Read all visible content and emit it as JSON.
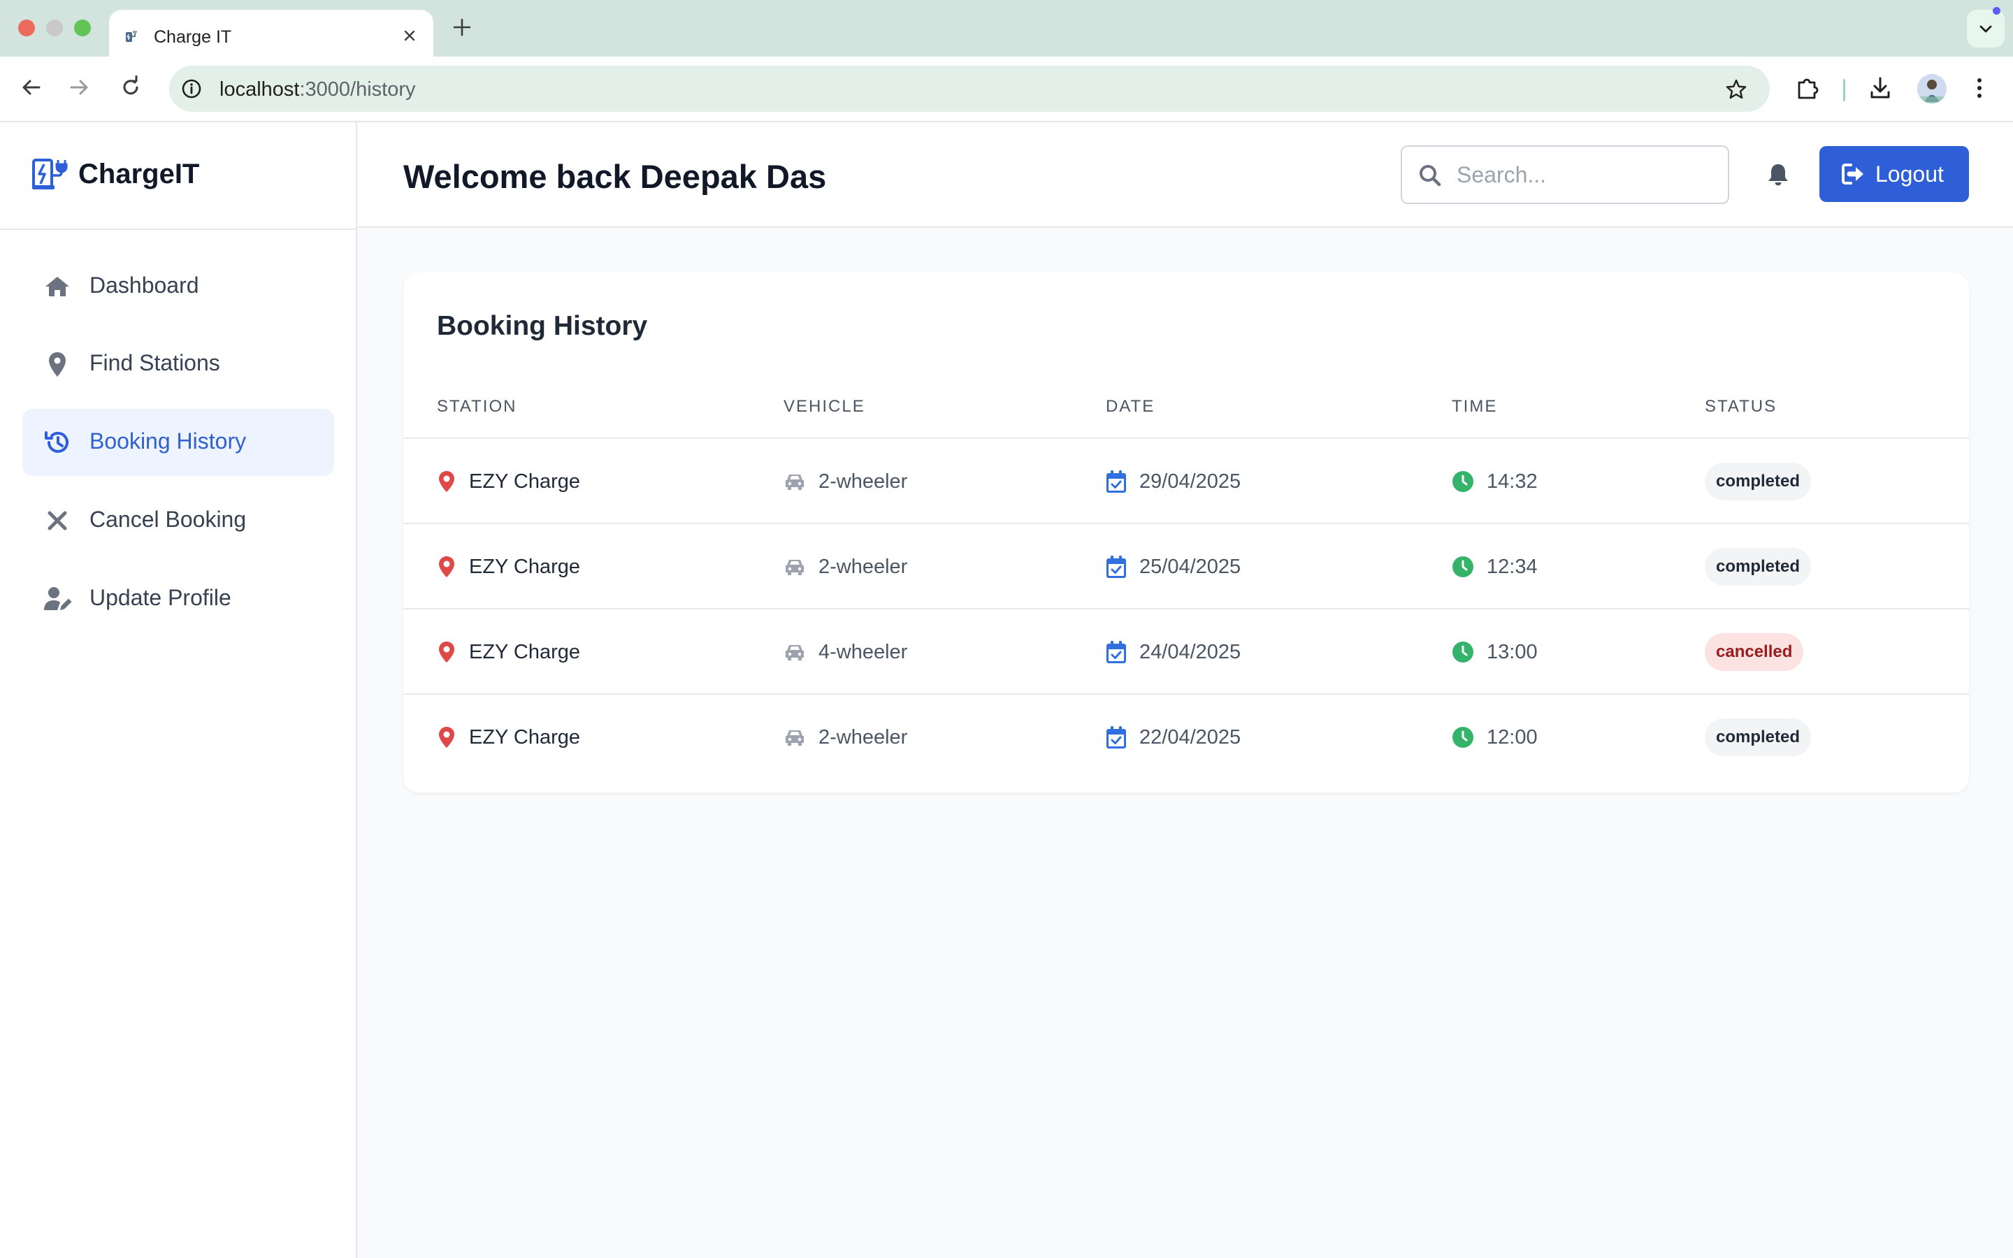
{
  "browser": {
    "tab_title": "Charge IT",
    "url_host": "localhost",
    "url_rest": ":3000/history"
  },
  "sidebar": {
    "brand": "ChargeIT",
    "items": [
      {
        "label": "Dashboard",
        "icon": "home-icon"
      },
      {
        "label": "Find Stations",
        "icon": "map-pin-icon"
      },
      {
        "label": "Booking History",
        "icon": "history-icon",
        "active": true
      },
      {
        "label": "Cancel Booking",
        "icon": "x-icon"
      },
      {
        "label": "Update Profile",
        "icon": "user-edit-icon"
      }
    ]
  },
  "header": {
    "welcome": "Welcome back Deepak Das",
    "search_placeholder": "Search...",
    "logout_label": "Logout"
  },
  "bookings": {
    "title": "Booking History",
    "columns": [
      "STATION",
      "VEHICLE",
      "DATE",
      "TIME",
      "STATUS"
    ],
    "rows": [
      {
        "station": "EZY Charge",
        "vehicle": "2-wheeler",
        "date": "29/04/2025",
        "time": "14:32",
        "status": "completed"
      },
      {
        "station": "EZY Charge",
        "vehicle": "2-wheeler",
        "date": "25/04/2025",
        "time": "12:34",
        "status": "completed"
      },
      {
        "station": "EZY Charge",
        "vehicle": "4-wheeler",
        "date": "24/04/2025",
        "time": "13:00",
        "status": "cancelled"
      },
      {
        "station": "EZY Charge",
        "vehicle": "2-wheeler",
        "date": "22/04/2025",
        "time": "12:00",
        "status": "completed"
      }
    ]
  },
  "colors": {
    "accent": "#2f5fd8",
    "active_bg": "#eef4ff",
    "pin": "#e04848",
    "calendar": "#2f6fe0",
    "clock": "#34b36b",
    "cancelled_bg": "#fde2e2",
    "cancelled_text": "#9b1c1c"
  }
}
